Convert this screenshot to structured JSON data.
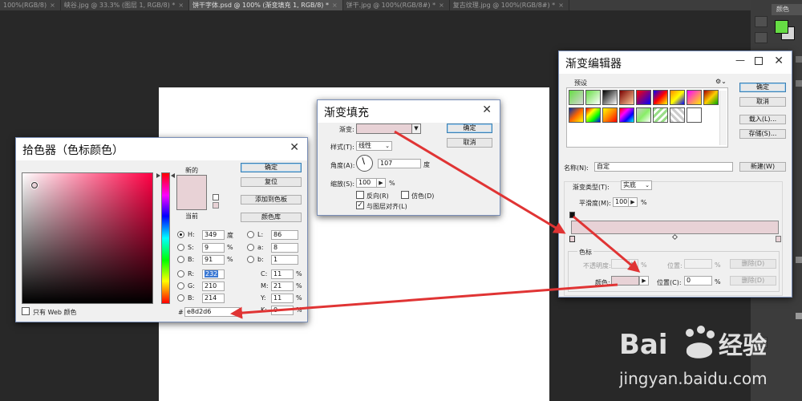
{
  "tabs": [
    {
      "label": "100%(RGB/8)",
      "active": false
    },
    {
      "label": "峡谷.jpg @ 33.3% (图层 1, RGB/8) *",
      "active": false
    },
    {
      "label": "饼干字体.psd @ 100% (渐变填充 1, RGB/8) *",
      "active": true
    },
    {
      "label": "饼干.jpg @ 100%(RGB/8#) *",
      "active": false
    },
    {
      "label": "复古纹理.jpg @ 100%(RGB/8#) *",
      "active": false
    }
  ],
  "right_panel": {
    "title": "颜色",
    "fg_color": "#66dd44",
    "bg_color": "#d6d6d6"
  },
  "color_picker": {
    "title": "拾色器（色标颜色）",
    "new_label": "新的",
    "current_label": "当前",
    "new_color": "#e8d2d6",
    "current_color": "#e8d2d6",
    "buttons": {
      "ok": "确定",
      "reset": "复位",
      "add_swatch": "添加到色板",
      "libraries": "颜色库"
    },
    "fields": {
      "H": {
        "label": "H:",
        "value": "349",
        "unit": "度"
      },
      "S": {
        "label": "S:",
        "value": "9",
        "unit": "%"
      },
      "B": {
        "label": "B:",
        "value": "91",
        "unit": "%"
      },
      "R": {
        "label": "R:",
        "value": "232"
      },
      "G": {
        "label": "G:",
        "value": "210"
      },
      "Bl": {
        "label": "B:",
        "value": "214"
      },
      "L": {
        "label": "L:",
        "value": "86"
      },
      "a": {
        "label": "a:",
        "value": "8"
      },
      "b": {
        "label": "b:",
        "value": "1"
      },
      "C": {
        "label": "C:",
        "value": "11",
        "unit": "%"
      },
      "M": {
        "label": "M:",
        "value": "21",
        "unit": "%"
      },
      "Y": {
        "label": "Y:",
        "value": "11",
        "unit": "%"
      },
      "K": {
        "label": "K:",
        "value": "0",
        "unit": "%"
      }
    },
    "hex_label": "#",
    "hex_value": "e8d2d6",
    "web_only_label": "只有 Web 颜色"
  },
  "gradient_fill": {
    "title": "渐变填充",
    "gradient_label": "渐变:",
    "style_label": "样式(T):",
    "style_value": "线性",
    "angle_label": "角度(A):",
    "angle_value": "107",
    "angle_unit": "度",
    "scale_label": "缩放(S):",
    "scale_value": "100",
    "scale_unit": "%",
    "reverse_label": "反向(R)",
    "dither_label": "仿色(D)",
    "align_label": "与图层对齐(L)",
    "ok": "确定",
    "cancel": "取消",
    "gradient_color": "#e8d2d6"
  },
  "gradient_editor": {
    "title": "渐变编辑器",
    "presets_label": "预设",
    "ok": "确定",
    "cancel": "取消",
    "load": "载入(L)...",
    "save": "存储(S)...",
    "name_label": "名称(N):",
    "name_value": "自定",
    "new_button": "新建(W)",
    "type_label": "渐变类型(T):",
    "type_value": "实底",
    "smooth_label": "平滑度(M):",
    "smooth_value": "100",
    "smooth_unit": "%",
    "stops_label": "色标",
    "opacity_label": "不透明度:",
    "opacity_unit": "%",
    "location_label": "位置:",
    "location_unit": "%",
    "delete_label": "删除(D)",
    "color_label": "颜色:",
    "color_location_label": "位置(C):",
    "color_location_value": "0",
    "color_location_unit": "%",
    "delete_color_label": "删除(D)",
    "stop_color": "#e8d2d6"
  },
  "watermark": {
    "brand_left": "Bai",
    "brand_right": "经验",
    "url": "jingyan.baidu.com"
  }
}
